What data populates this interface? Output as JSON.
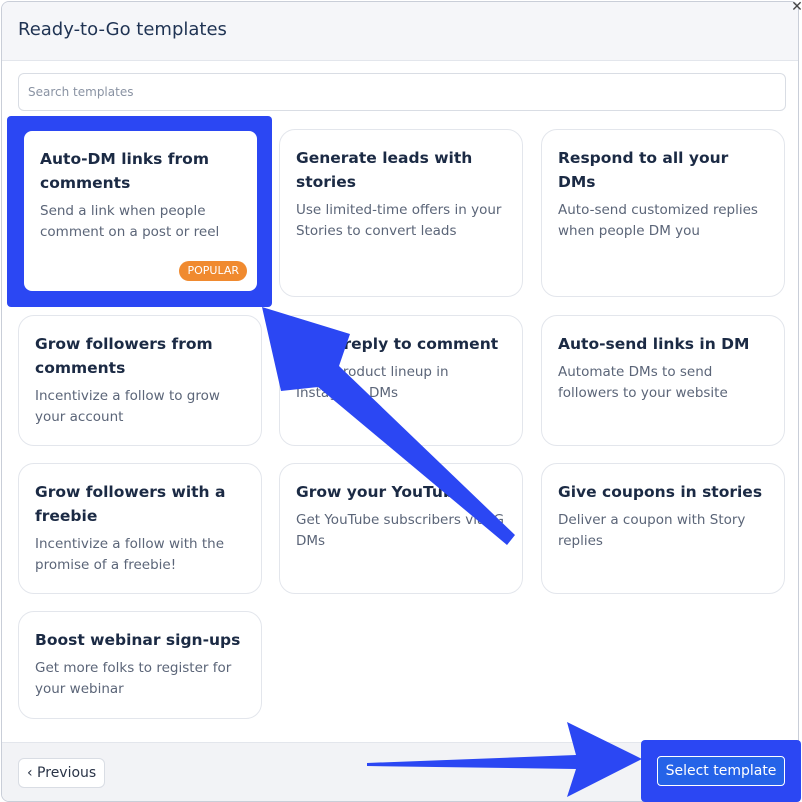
{
  "header": {
    "title": "Ready-to-Go templates",
    "close_icon": "close-icon"
  },
  "search": {
    "placeholder": "Search templates",
    "value": ""
  },
  "templates": [
    {
      "title": "Auto-DM links from comments",
      "description": "Send a link when people comment on a post or reel",
      "badge": "POPULAR"
    },
    {
      "title": "Generate leads with stories",
      "description": "Use limited-time offers in your Stories to convert leads"
    },
    {
      "title": "Respond to all your DMs",
      "description": "Auto-send customized replies when people DM you"
    },
    {
      "title": "Grow followers from comments",
      "description": "Incentivize a follow to grow your account"
    },
    {
      "title": "Auto-reply to comment",
      "description": "Send product lineup in Instagram DMs"
    },
    {
      "title": "Auto-send links in DM",
      "description": "Automate DMs to send followers to your website"
    },
    {
      "title": "Grow followers with a freebie",
      "description": "Incentivize a follow with the promise of a freebie!"
    },
    {
      "title": "Grow your YouTube",
      "description": "Get YouTube subscribers via IG DMs"
    },
    {
      "title": "Give coupons in stories",
      "description": "Deliver a coupon with Story replies"
    },
    {
      "title": "Boost webinar sign-ups",
      "description": "Get more folks to register for your webinar"
    }
  ],
  "footer": {
    "previous_label": "‹ Previous",
    "select_label": "Select template"
  },
  "colors": {
    "annotation_blue": "#2b47f3",
    "badge_orange": "#f08a2f",
    "primary_button": "#2563e8"
  }
}
